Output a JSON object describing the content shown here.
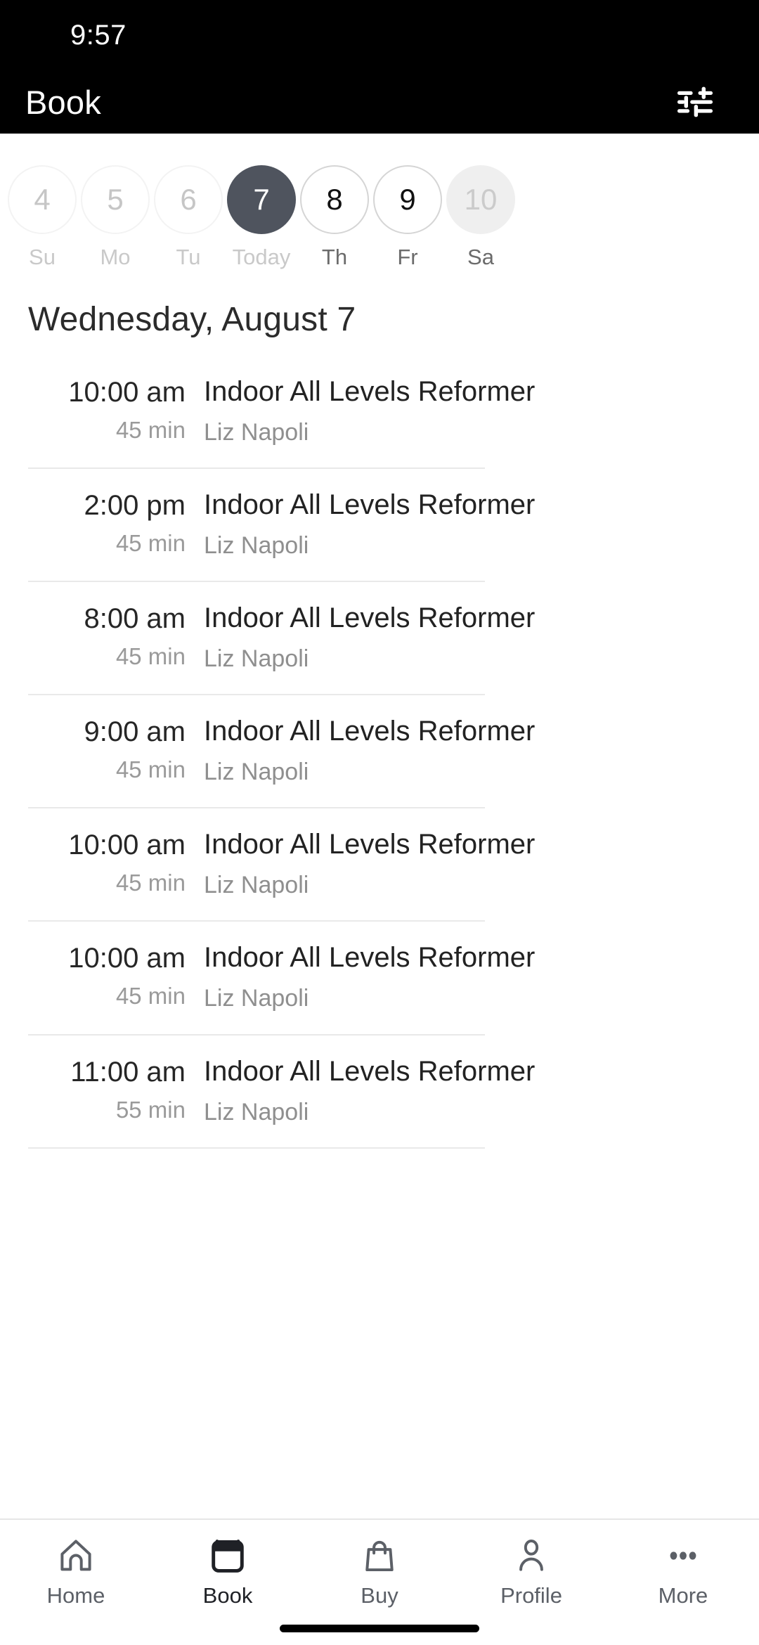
{
  "status": {
    "time": "9:57"
  },
  "appbar": {
    "title": "Book",
    "filter_icon": "filter-sliders-icon"
  },
  "theme": {
    "header_bg": "#000000",
    "selected_day_bg": "#4f545e",
    "body_bg": "#ffffff",
    "muted_text": "#9a9a9a",
    "primary_text": "#222222"
  },
  "datestrip": {
    "days": [
      {
        "number": "4",
        "label": "Su",
        "state": "past"
      },
      {
        "number": "5",
        "label": "Mo",
        "state": "past"
      },
      {
        "number": "6",
        "label": "Tu",
        "state": "past"
      },
      {
        "number": "7",
        "label": "Today",
        "state": "selected"
      },
      {
        "number": "8",
        "label": "Th",
        "state": "avail"
      },
      {
        "number": "9",
        "label": "Fr",
        "state": "avail"
      },
      {
        "number": "10",
        "label": "Sa",
        "state": "muted"
      }
    ]
  },
  "day_heading": "Wednesday, August 7",
  "classes": [
    {
      "time": "10:00 am",
      "duration": "45 min",
      "name": "Indoor All Levels Reformer",
      "teacher": "Liz Napoli"
    },
    {
      "time": "2:00 pm",
      "duration": "45 min",
      "name": "Indoor All Levels Reformer",
      "teacher": "Liz Napoli"
    },
    {
      "time": "8:00 am",
      "duration": "45 min",
      "name": "Indoor All Levels Reformer",
      "teacher": "Liz Napoli"
    },
    {
      "time": "9:00 am",
      "duration": "45 min",
      "name": "Indoor All Levels Reformer",
      "teacher": "Liz Napoli"
    },
    {
      "time": "10:00 am",
      "duration": "45 min",
      "name": "Indoor All Levels Reformer",
      "teacher": "Liz Napoli"
    },
    {
      "time": "10:00 am",
      "duration": "45 min",
      "name": "Indoor All Levels Reformer",
      "teacher": "Liz Napoli"
    },
    {
      "time": "11:00 am",
      "duration": "55 min",
      "name": "Indoor All Levels Reformer",
      "teacher": "Liz Napoli"
    }
  ],
  "bottomnav": {
    "items": [
      {
        "label": "Home",
        "icon": "home-icon",
        "active": false
      },
      {
        "label": "Book",
        "icon": "calendar-icon",
        "active": true
      },
      {
        "label": "Buy",
        "icon": "bag-icon",
        "active": false
      },
      {
        "label": "Profile",
        "icon": "person-icon",
        "active": false
      },
      {
        "label": "More",
        "icon": "ellipsis-icon",
        "active": false
      }
    ]
  }
}
